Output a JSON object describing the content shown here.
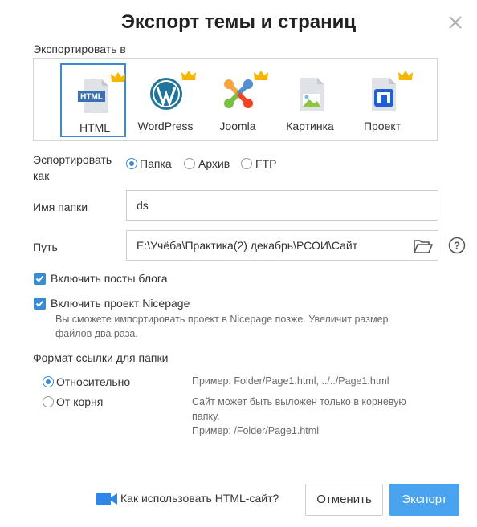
{
  "dialog": {
    "title": "Экспорт темы и страниц",
    "export_to_label": "Экспортировать в",
    "targets": [
      {
        "label": "HTML",
        "icon": "html-file-icon",
        "selected": true
      },
      {
        "label": "WordPress",
        "icon": "wordpress-icon",
        "selected": false
      },
      {
        "label": "Joomla",
        "icon": "joomla-icon",
        "selected": false
      },
      {
        "label": "Картинка",
        "icon": "image-file-icon",
        "selected": false
      },
      {
        "label": "Проект",
        "icon": "nicepage-project-icon",
        "selected": false
      }
    ],
    "html_icon_text": "HTML",
    "export_as_label": "Эспортировать как",
    "export_as_options": [
      {
        "label": "Папка",
        "selected": true
      },
      {
        "label": "Архив",
        "selected": false
      },
      {
        "label": "FTP",
        "selected": false
      }
    ],
    "folder_name_label": "Имя папки",
    "folder_name_value": "ds",
    "path_label": "Путь",
    "path_value": "E:\\Учёба\\Практика(2) декабрь\\РСОИ\\Сайт",
    "include_blog_label": "Включить посты блога",
    "include_project_label": "Включить проект Nicepage",
    "include_project_note": "Вы сможете импортировать проект в Nicepage позже. Увеличит размер файлов два раза.",
    "link_format_label": "Формат ссылки для папки",
    "link_relative_label": "Относительно",
    "link_relative_note": "Пример: Folder/Page1.html, ../../Page1.html",
    "link_root_label": "От корня",
    "link_root_note_1": "Сайт может быть выложен только в корневую папку.",
    "link_root_note_2": "Пример: /Folder/Page1.html",
    "help_link_label": "Как использовать HTML-сайт?",
    "cancel_label": "Отменить",
    "export_label": "Экспорт",
    "colors": {
      "accent": "#3a8ad6",
      "export_button": "#4aa3ee",
      "crown": "#f5b800"
    }
  }
}
